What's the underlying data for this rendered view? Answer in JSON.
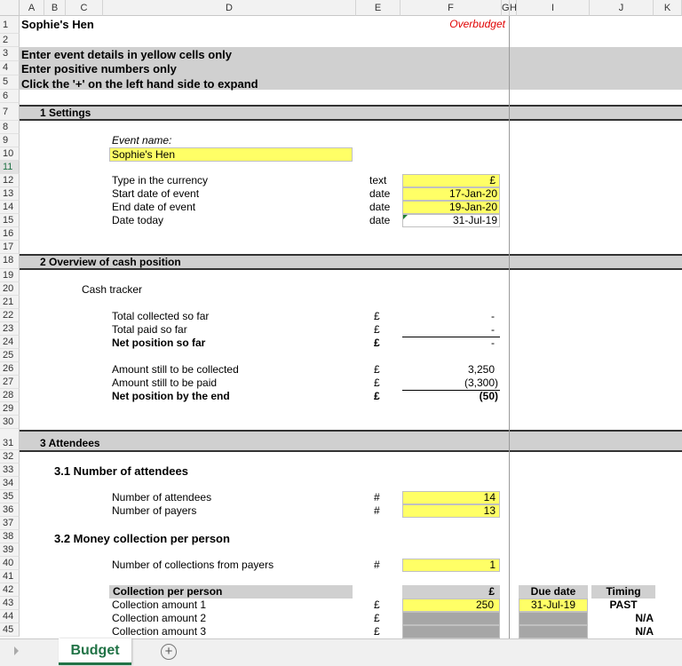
{
  "columns": [
    "A",
    "B",
    "C",
    "D",
    "E",
    "F",
    "G",
    "H",
    "I",
    "J",
    "K"
  ],
  "rows": [
    "1",
    "2",
    "3",
    "4",
    "5",
    "6",
    "7",
    "8",
    "9",
    "10",
    "11",
    "12",
    "13",
    "14",
    "15",
    "16",
    "17",
    "18",
    "19",
    "20",
    "21",
    "22",
    "23",
    "24",
    "25",
    "26",
    "27",
    "28",
    "29",
    "30",
    "31",
    "32",
    "33",
    "34",
    "35",
    "36",
    "37",
    "38",
    "39",
    "40",
    "41",
    "42",
    "43",
    "44",
    "45"
  ],
  "title": "Sophie's Hen",
  "status": "Overbudget",
  "instructions": {
    "line1": "Enter event details in yellow cells only",
    "line2": "Enter positive numbers only",
    "line3": "Click the '+' on the left hand side to expand"
  },
  "settings": {
    "header": "1 Settings",
    "event_name_label": "Event name:",
    "event_name_value": "Sophie's Hen",
    "currency_label": "Type in the currency",
    "currency_type": "text",
    "currency_value": "£",
    "start_label": "Start date of event",
    "start_type": "date",
    "start_value": "17-Jan-20",
    "end_label": "End date of event",
    "end_type": "date",
    "end_value": "19-Jan-20",
    "today_label": "Date today",
    "today_type": "date",
    "today_value": "31-Jul-19"
  },
  "overview": {
    "header": "2 Overview of cash position",
    "tracker": "Cash tracker",
    "collected_label": "Total collected so far",
    "collected_value": "-",
    "paid_label": "Total paid so far",
    "paid_value": "-",
    "net_label": "Net position so far",
    "net_value": "-",
    "still_collect_label": "Amount still to be collected",
    "still_collect_value": "3,250",
    "still_paid_label": "Amount still to be paid",
    "still_paid_value": "(3,300)",
    "net_end_label": "Net position by the end",
    "net_end_value": "(50)",
    "currency": "£"
  },
  "attendees": {
    "header": "3 Attendees",
    "sub1": "3.1  Number of attendees",
    "num_attendees_label": "Number of attendees",
    "num_attendees_value": "14",
    "num_payers_label": "Number of payers",
    "num_payers_value": "13",
    "hash": "#",
    "sub2": "3.2  Money collection per person",
    "num_collections_label": "Number of collections from payers",
    "num_collections_value": "1",
    "collection_header": "Collection per person",
    "currency_header": "£",
    "due_date_header": "Due date",
    "timing_header": "Timing",
    "c1_label": "Collection amount 1",
    "c1_value": "250",
    "c1_due": "31-Jul-19",
    "c1_timing": "PAST",
    "c2_label": "Collection amount 2",
    "c2_timing": "N/A",
    "c3_label": "Collection amount 3",
    "c3_timing": "N/A"
  },
  "tabs": {
    "active": "Budget",
    "add": "+"
  }
}
